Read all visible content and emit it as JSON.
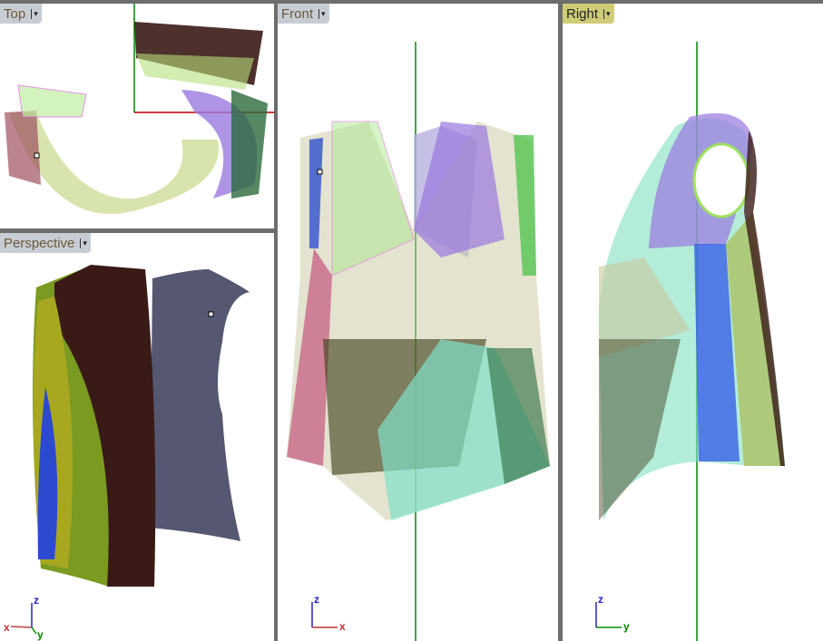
{
  "viewports": [
    {
      "name": "Top",
      "active": false
    },
    {
      "name": "Perspective",
      "active": false
    },
    {
      "name": "Front",
      "active": false
    },
    {
      "name": "Right",
      "active": true
    }
  ],
  "axes": {
    "x": "x",
    "y": "y",
    "z": "z"
  },
  "dropdown_icon": "▾",
  "colors": {
    "active_label": "#cfcc78",
    "inactive_label": "#c8ccd4",
    "grid_x": "#b40000",
    "grid_y": "#008000"
  }
}
